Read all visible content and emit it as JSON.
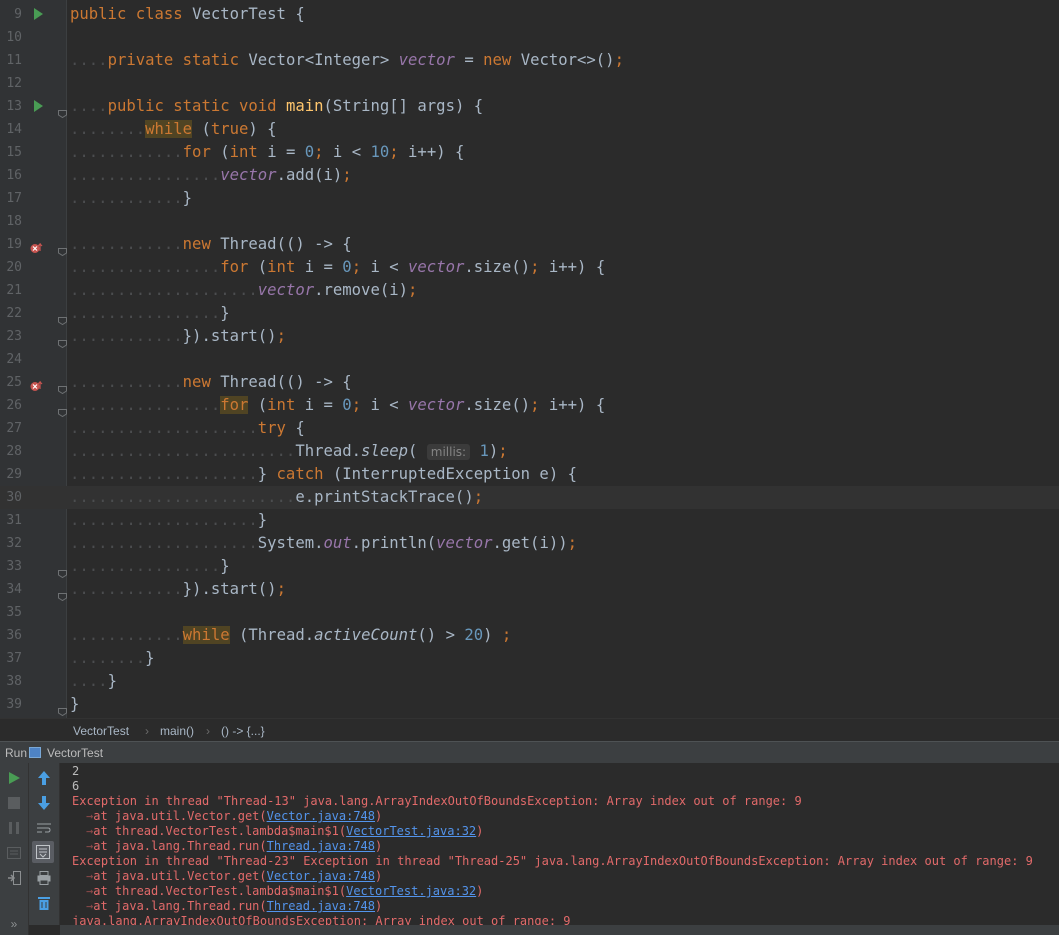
{
  "colors": {
    "editor_bg": "#2b2b2b",
    "keyword": "#cc7832",
    "method_decl": "#ffc66d",
    "number": "#6897bb",
    "field": "#9876aa",
    "text": "#a9b7c6",
    "error": "#e26a6a",
    "link": "#5394ec",
    "run_green": "#499c54"
  },
  "editor": {
    "line_numbers": [
      "9",
      "10",
      "11",
      "12",
      "13",
      "14",
      "15",
      "16",
      "17",
      "18",
      "19",
      "20",
      "21",
      "22",
      "23",
      "24",
      "25",
      "26",
      "27",
      "28",
      "29",
      "30",
      "31",
      "32",
      "33",
      "34",
      "35",
      "36",
      "37",
      "38",
      "39"
    ],
    "lines": [
      [
        {
          "c": "kw",
          "t": "public "
        },
        {
          "c": "kw",
          "t": "class "
        },
        {
          "t": "VectorTest {"
        }
      ],
      [],
      [
        {
          "c": "dots",
          "t": "...."
        },
        {
          "c": "kw",
          "t": "private "
        },
        {
          "c": "kw",
          "t": "static "
        },
        {
          "t": "Vector<Integer> "
        },
        {
          "c": "fi",
          "t": "vector"
        },
        {
          "t": " = "
        },
        {
          "c": "kw",
          "t": "new "
        },
        {
          "t": "Vector<>()"
        },
        {
          "c": "kw",
          "t": ";"
        }
      ],
      [],
      [
        {
          "c": "dots",
          "t": "...."
        },
        {
          "c": "kw",
          "t": "public "
        },
        {
          "c": "kw",
          "t": "static "
        },
        {
          "c": "kw",
          "t": "void "
        },
        {
          "c": "fn",
          "t": "main"
        },
        {
          "t": "(String[] args) {"
        }
      ],
      [
        {
          "c": "dots",
          "t": "........"
        },
        {
          "c": "kw hl",
          "t": "while"
        },
        {
          "t": " ("
        },
        {
          "c": "kw",
          "t": "true"
        },
        {
          "t": ") {"
        }
      ],
      [
        {
          "c": "dots",
          "t": "............"
        },
        {
          "c": "kw",
          "t": "for "
        },
        {
          "t": "("
        },
        {
          "c": "kw",
          "t": "int "
        },
        {
          "t": "i = "
        },
        {
          "c": "num",
          "t": "0"
        },
        {
          "c": "kw",
          "t": "; "
        },
        {
          "t": "i < "
        },
        {
          "c": "num",
          "t": "10"
        },
        {
          "c": "kw",
          "t": "; "
        },
        {
          "t": "i++) {"
        }
      ],
      [
        {
          "c": "dots",
          "t": "................"
        },
        {
          "c": "fi",
          "t": "vector"
        },
        {
          "t": ".add(i)"
        },
        {
          "c": "kw",
          "t": ";"
        }
      ],
      [
        {
          "c": "dots",
          "t": "............"
        },
        {
          "t": "}"
        }
      ],
      [],
      [
        {
          "c": "dots",
          "t": "............"
        },
        {
          "c": "kw",
          "t": "new "
        },
        {
          "t": "Thread(() -> {"
        }
      ],
      [
        {
          "c": "dots",
          "t": "................"
        },
        {
          "c": "kw",
          "t": "for "
        },
        {
          "t": "("
        },
        {
          "c": "kw",
          "t": "int "
        },
        {
          "t": "i = "
        },
        {
          "c": "num",
          "t": "0"
        },
        {
          "c": "kw",
          "t": "; "
        },
        {
          "t": "i < "
        },
        {
          "c": "fi",
          "t": "vector"
        },
        {
          "t": ".size()"
        },
        {
          "c": "kw",
          "t": "; "
        },
        {
          "t": "i++) {"
        }
      ],
      [
        {
          "c": "dots",
          "t": "...................."
        },
        {
          "c": "fi",
          "t": "vector"
        },
        {
          "t": ".remove(i)"
        },
        {
          "c": "kw",
          "t": ";"
        }
      ],
      [
        {
          "c": "dots",
          "t": "................"
        },
        {
          "t": "}"
        }
      ],
      [
        {
          "c": "dots",
          "t": "............"
        },
        {
          "t": "}).start()"
        },
        {
          "c": "kw",
          "t": ";"
        }
      ],
      [],
      [
        {
          "c": "dots",
          "t": "............"
        },
        {
          "c": "kw",
          "t": "new "
        },
        {
          "t": "Thread(() -> {"
        }
      ],
      [
        {
          "c": "dots",
          "t": "................"
        },
        {
          "c": "kw hl",
          "t": "for"
        },
        {
          "t": " ("
        },
        {
          "c": "kw",
          "t": "int "
        },
        {
          "t": "i = "
        },
        {
          "c": "num",
          "t": "0"
        },
        {
          "c": "kw",
          "t": "; "
        },
        {
          "t": "i < "
        },
        {
          "c": "fi",
          "t": "vector"
        },
        {
          "t": ".size()"
        },
        {
          "c": "kw",
          "t": "; "
        },
        {
          "t": "i++) {"
        }
      ],
      [
        {
          "c": "dots",
          "t": "...................."
        },
        {
          "c": "kw",
          "t": "try "
        },
        {
          "t": "{"
        }
      ],
      [
        {
          "c": "dots",
          "t": "........................"
        },
        {
          "t": "Thread."
        },
        {
          "c": "it",
          "t": "sleep"
        },
        {
          "t": "( "
        },
        {
          "c": "hint",
          "t": "millis:"
        },
        {
          "t": " "
        },
        {
          "c": "num",
          "t": "1"
        },
        {
          "t": ")"
        },
        {
          "c": "kw",
          "t": ";"
        }
      ],
      [
        {
          "c": "dots",
          "t": "...................."
        },
        {
          "t": "} "
        },
        {
          "c": "kw",
          "t": "catch "
        },
        {
          "t": "(InterruptedException e) {"
        }
      ],
      [
        {
          "c": "dots",
          "t": "........................"
        },
        {
          "t": "e.printStackTrace()"
        },
        {
          "c": "kw",
          "t": ";"
        }
      ],
      [
        {
          "c": "dots",
          "t": "...................."
        },
        {
          "t": "}"
        }
      ],
      [
        {
          "c": "dots",
          "t": "...................."
        },
        {
          "t": "System."
        },
        {
          "c": "fi",
          "t": "out"
        },
        {
          "t": ".println("
        },
        {
          "c": "fi",
          "t": "vector"
        },
        {
          "t": ".get(i))"
        },
        {
          "c": "kw",
          "t": ";"
        }
      ],
      [
        {
          "c": "dots",
          "t": "................"
        },
        {
          "t": "}"
        }
      ],
      [
        {
          "c": "dots",
          "t": "............"
        },
        {
          "t": "}).start()"
        },
        {
          "c": "kw",
          "t": ";"
        }
      ],
      [],
      [
        {
          "c": "dots",
          "t": "............"
        },
        {
          "c": "kw hl",
          "t": "while"
        },
        {
          "t": " (Thread."
        },
        {
          "c": "it",
          "t": "activeCount"
        },
        {
          "t": "() > "
        },
        {
          "c": "num",
          "t": "20"
        },
        {
          "t": ") "
        },
        {
          "c": "kw",
          "t": ";"
        }
      ],
      [
        {
          "c": "dots",
          "t": "........"
        },
        {
          "t": "}"
        }
      ],
      [
        {
          "c": "dots",
          "t": "...."
        },
        {
          "t": "}"
        }
      ],
      [
        {
          "t": "}"
        }
      ]
    ]
  },
  "breadcrumb": {
    "class_name": "VectorTest",
    "sep1": "›",
    "method": "main()",
    "sep2": "›",
    "lambda": "() -> {...}"
  },
  "run_panel": {
    "label": "Run",
    "tab_title": "VectorTest",
    "tab_icon": "run-config-icon"
  },
  "console": {
    "lines": [
      {
        "kind": "norm",
        "parts": [
          {
            "t": "2"
          }
        ]
      },
      {
        "kind": "norm",
        "parts": [
          {
            "t": "6"
          }
        ]
      },
      {
        "kind": "err",
        "parts": [
          {
            "t": "Exception in thread \"Thread-13\" java.lang.ArrayIndexOutOfBoundsException: Array index out of range: 9"
          }
        ]
      },
      {
        "kind": "err",
        "parts": [
          {
            "c": "arrow",
            "t": "→"
          },
          {
            "t": "at java.util.Vector.get("
          },
          {
            "c": "link",
            "t": "Vector.java:748"
          },
          {
            "t": ")"
          }
        ]
      },
      {
        "kind": "err",
        "parts": [
          {
            "c": "arrow",
            "t": "→"
          },
          {
            "t": "at thread.VectorTest.lambda$main$1("
          },
          {
            "c": "link",
            "t": "VectorTest.java:32"
          },
          {
            "t": ")"
          }
        ]
      },
      {
        "kind": "err",
        "parts": [
          {
            "c": "arrow",
            "t": "→"
          },
          {
            "t": "at java.lang.Thread.run("
          },
          {
            "c": "link",
            "t": "Thread.java:748"
          },
          {
            "t": ")"
          }
        ]
      },
      {
        "kind": "err",
        "parts": [
          {
            "t": "Exception in thread \"Thread-23\" Exception in thread \"Thread-25\" java.lang.ArrayIndexOutOfBoundsException: Array index out of range: 9"
          }
        ]
      },
      {
        "kind": "err",
        "parts": [
          {
            "c": "arrow",
            "t": "→"
          },
          {
            "t": "at java.util.Vector.get("
          },
          {
            "c": "link",
            "t": "Vector.java:748"
          },
          {
            "t": ")"
          }
        ]
      },
      {
        "kind": "err",
        "parts": [
          {
            "c": "arrow",
            "t": "→"
          },
          {
            "t": "at thread.VectorTest.lambda$main$1("
          },
          {
            "c": "link",
            "t": "VectorTest.java:32"
          },
          {
            "t": ")"
          }
        ]
      },
      {
        "kind": "err",
        "parts": [
          {
            "c": "arrow",
            "t": "→"
          },
          {
            "t": "at java.lang.Thread.run("
          },
          {
            "c": "link",
            "t": "Thread.java:748"
          },
          {
            "t": ")"
          }
        ]
      },
      {
        "kind": "err",
        "parts": [
          {
            "t": "java.lang.ArrayIndexOutOfBoundsException: Array index out of range: 9"
          }
        ]
      }
    ]
  },
  "toolbar": {
    "left_icons": [
      "rerun-icon",
      "stop-icon",
      "pause-icon",
      "dump-threads-icon",
      "exit-icon",
      "more-icon"
    ],
    "more_label": "»",
    "right_icons": [
      "scroll-up-icon",
      "scroll-down-icon",
      "soft-wrap-icon",
      "scroll-to-end-icon",
      "print-icon",
      "trash-icon"
    ]
  }
}
